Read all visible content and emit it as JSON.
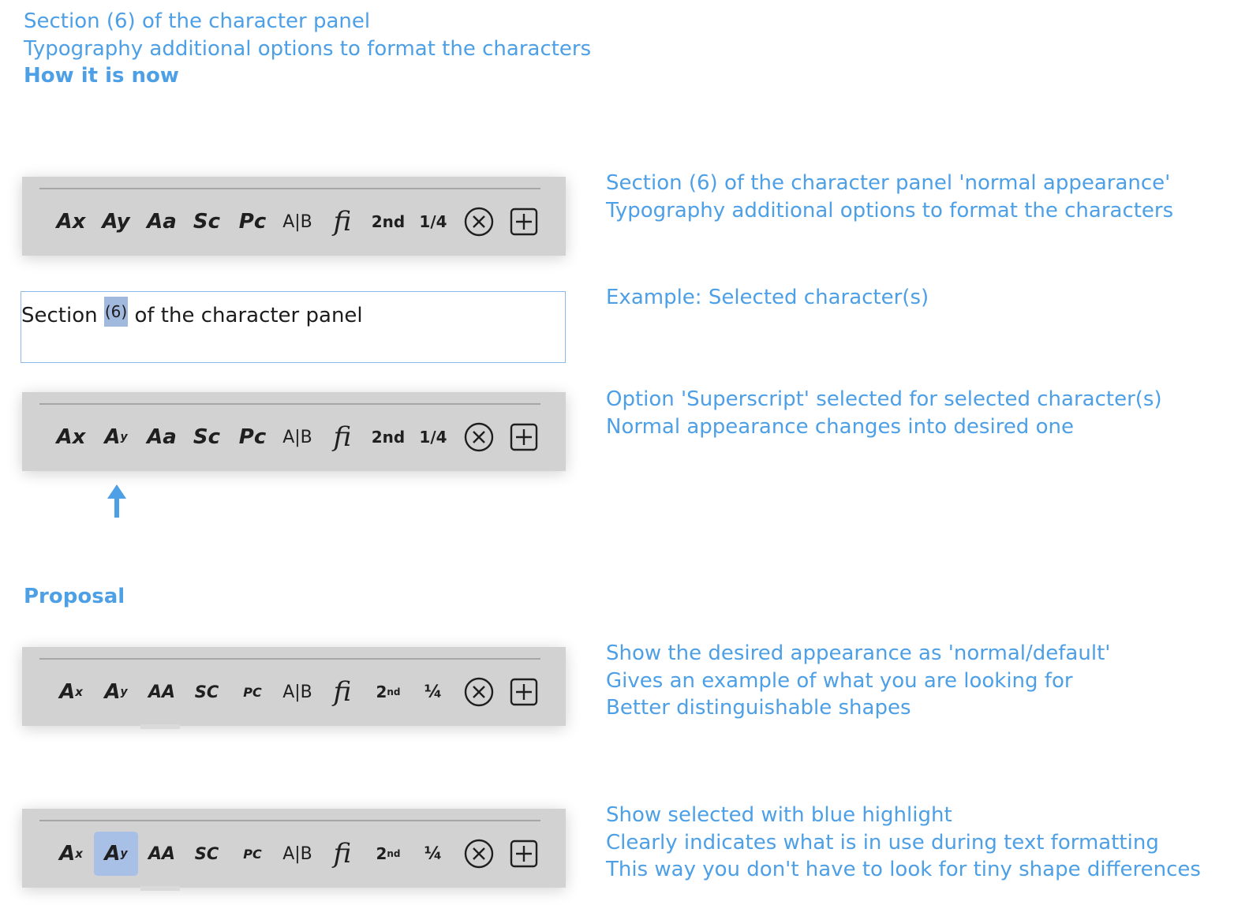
{
  "header": {
    "line1": "Section (6) of the character panel",
    "line2": "Typography additional options to format the characters",
    "now_heading": "How it is now"
  },
  "proposal_heading": "Proposal",
  "notes": {
    "normal": [
      "Section (6) of the character panel 'normal appearance'",
      "Typography additional options to format the characters"
    ],
    "example": [
      "Example: Selected character(s)"
    ],
    "superscript": [
      "Option 'Superscript' selected for selected character(s)",
      "Normal appearance changes into desired one"
    ],
    "proposal_default": [
      "Show the desired appearance as 'normal/default'",
      "Gives an example of what you are looking for",
      "Better distinguishable shapes"
    ],
    "proposal_selected": [
      "Show selected with blue highlight",
      "Clearly indicates what is in use during text formatting",
      "This way you don't have to look for tiny shape differences"
    ]
  },
  "example_text": {
    "before": "Section ",
    "selected": "(6)",
    "after": " of the character panel"
  },
  "current_panel": {
    "subscript": "Ax",
    "superscript": "Ay",
    "superscript_alt_base": "A",
    "superscript_alt_sup": "y",
    "caps": "Aa",
    "small_caps": "Sc",
    "petite_caps": "Pc",
    "contextual": "A|B",
    "ligature": "fi",
    "ordinal": "2nd",
    "fraction": "1/4"
  },
  "proposal_panel": {
    "subscript_base": "A",
    "subscript_sub": "x",
    "superscript_base": "A",
    "superscript_sup": "y",
    "caps": "AA",
    "small_caps": "SC",
    "petite_caps": "PC",
    "contextual": "A|B",
    "ligature": "fi",
    "ordinal_base": "2",
    "ordinal_sup": "nd",
    "fraction": "¼"
  },
  "icons": {
    "clear": "circle-x-icon",
    "add": "square-plus-icon"
  },
  "colors": {
    "annotation_blue": "#4d9fe6",
    "panel_gray": "#d2d2d2",
    "selected_highlight": "#a8bfe6",
    "text_selection": "#a2b9de"
  }
}
